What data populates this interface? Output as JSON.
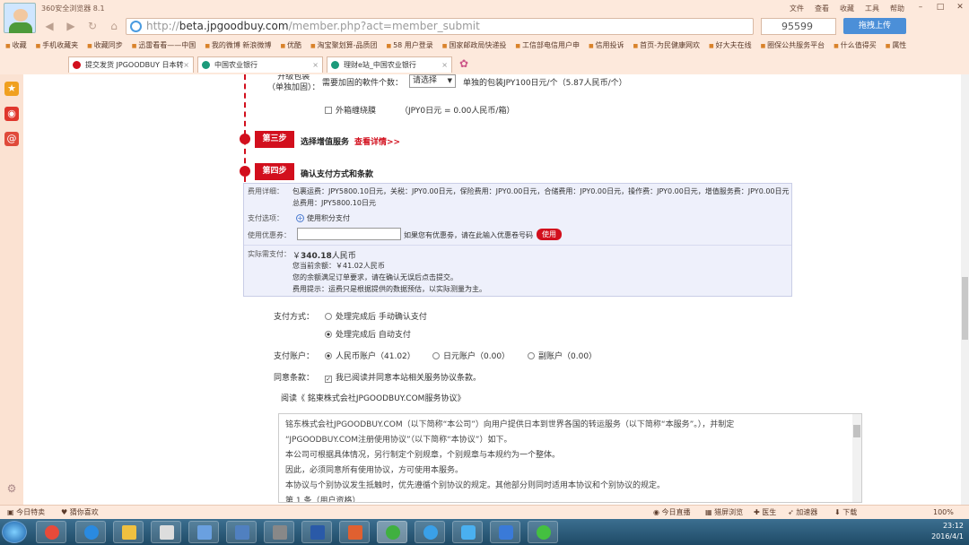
{
  "browser": {
    "brand": "360安全浏览器 8.1",
    "menu": [
      "文件",
      "查看",
      "收藏",
      "工具",
      "帮助"
    ],
    "url_host": "beta.jpgoodbuy.com",
    "url_prefix": "http://",
    "url_path": "/member.php?act=member_submit",
    "search_value": "95599",
    "upload_label": "拖拽上传",
    "favorites": [
      "收藏",
      "手机收藏夹",
      "收藏同步",
      "迅雷看看——中国",
      "我的微博 新浪微博",
      "优酷",
      "淘宝聚划算-品质团",
      "58 用户登录",
      "国家邮政局快递投",
      "工信部电信用户申",
      "信用投诉",
      "首页-为民健康网欢",
      "好大夫在线",
      "圈保公共服务平台",
      "什么值得买",
      "属性"
    ],
    "tabs": [
      {
        "label": "提交发货 JPGOODBUY 日本转",
        "color": "#d20f1d"
      },
      {
        "label": "中国农业银行",
        "color": "#1b9a7a"
      },
      {
        "label": "理财e站_中国农业银行",
        "color": "#1b9a7a"
      }
    ]
  },
  "page": {
    "package_label_line1": "升级包装",
    "package_label_line2": "（单独加固）：",
    "package_qty_label": "需要加固的軟件个数：",
    "package_select_value": "请选择",
    "package_price_note": "单独的包装JPY100日元/个（5.87人民币/个）",
    "outer_wrap_label": "外箱缠绕膜",
    "outer_wrap_price": "（JPY0日元 = 0.00人民币/箱）",
    "step3_badge": "第三步",
    "step3_title": "选择增值服务",
    "step3_link": "查看详情>>",
    "step4_badge": "第四步",
    "step4_title": "确认支付方式和条款",
    "fee": {
      "detail_label": "费用详细：",
      "detail_line1": "包裹运费：JPY5800.10日元，关税：JPY0.00日元，保险费用：JPY0.00日元，合储费用：JPY0.00日元，操作费：JPY0.00日元，增值服务费：JPY0.00日元",
      "detail_line2": "总费用：JPY5800.10日元",
      "pay_option_label": "支付选项：",
      "pay_option_value": "使用积分支付",
      "coupon_label": "使用优惠券：",
      "coupon_value": "",
      "coupon_hint": "如果您有优惠劵，请在此输入优惠卷号码",
      "coupon_button": "使用",
      "actual_label": "实际需支付：",
      "actual_amount_prefix": "￥",
      "actual_amount": "340.18",
      "actual_amount_unit": "人民币",
      "balance": "您当前余额：￥41.02人民币",
      "note1": "您的余额满足订单要求，请在确认无误后点击提交。",
      "note2": "费用提示：运费只是根据提供的数据预估，以实际测量为主。"
    },
    "pay_method_label": "支付方式：",
    "pay_method_options": [
      "处理完成后 手动确认支付",
      "处理完成后 自动支付"
    ],
    "pay_method_selected": 1,
    "pay_account_label": "支付账户：",
    "pay_account_options": [
      "人民币账户（41.02）",
      "日元账户（0.00）",
      "副账户（0.00）"
    ],
    "pay_account_selected": 0,
    "agree_label": "同意条款：",
    "agree_text": "我已阅读并同意本站相关服务协议条款。",
    "agree_checked": true,
    "read_link": "阅读《 銘東株式会社JPGOODBUY.COM服务协议》",
    "agreement_lines": [
      "铭东株式会社JPGOODBUY.COM（以下简称“本公司”）向用户提供日本到世界各国的转运服务（以下简称“本服务”。），并制定",
      "“JPGOODBUY.COM注册使用协议”（以下简称“本协议”）如下。",
      "本公司可根据具体情况，另行制定个别规章，个别规章与本规约为一个整体。",
      "因此，必须同意所有使用协议，方可使用本服务。",
      "本协议与个别协议发生抵触时，优先遵循个别协议的规定。其他部分则同时适用本协议和个别协议的规定。",
      "第 1 条（用户资格）"
    ]
  },
  "status": {
    "left1": "今日特卖",
    "left2": "猜你喜欢",
    "right": [
      "今日直播",
      "猎屏浏览",
      "医生",
      "加速器",
      "下载",
      "100%"
    ]
  },
  "taskbar": {
    "time": "23:12",
    "date": "2016/4/1"
  }
}
